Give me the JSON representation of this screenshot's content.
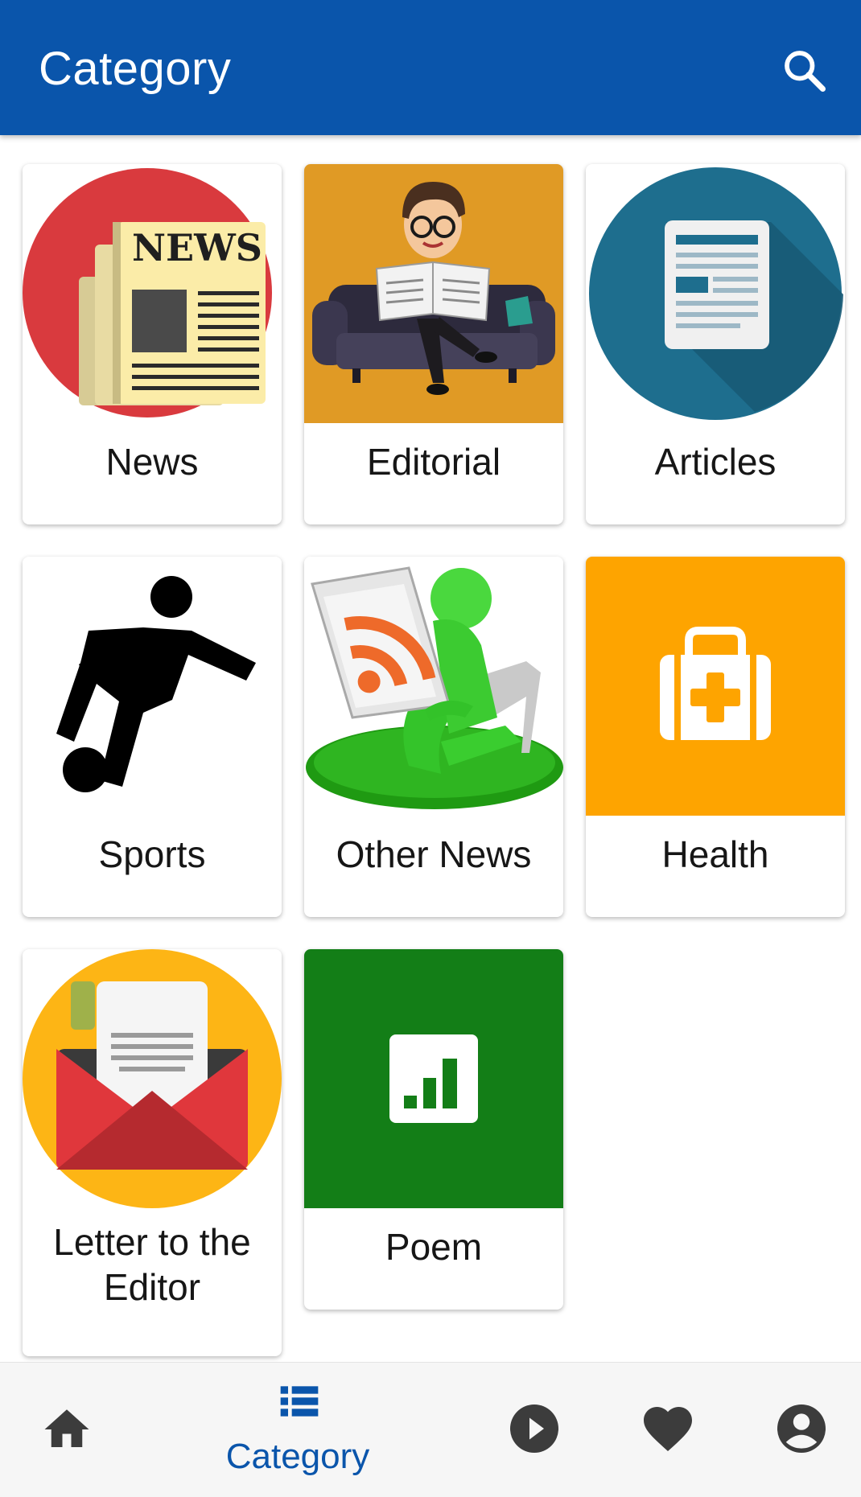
{
  "appbar": {
    "title": "Category",
    "search_icon": "search-icon"
  },
  "categories": [
    {
      "label": "News",
      "icon": "newspaper-icon"
    },
    {
      "label": "Editorial",
      "icon": "man-reading-newspaper-icon"
    },
    {
      "label": "Articles",
      "icon": "article-document-icon"
    },
    {
      "label": "Sports",
      "icon": "soccer-player-icon"
    },
    {
      "label": "Other News",
      "icon": "rss-reader-icon"
    },
    {
      "label": "Health",
      "icon": "medical-kit-icon"
    },
    {
      "label": "Letter to the Editor",
      "icon": "envelope-letter-icon"
    },
    {
      "label": "Poem",
      "icon": "signal-bars-icon"
    }
  ],
  "bottom_nav": {
    "items": [
      {
        "icon": "home-icon",
        "label": ""
      },
      {
        "icon": "list-icon",
        "label": "Category",
        "active": true
      },
      {
        "icon": "play-icon",
        "label": ""
      },
      {
        "icon": "heart-icon",
        "label": ""
      },
      {
        "icon": "account-icon",
        "label": ""
      }
    ]
  },
  "colors": {
    "primary": "#0a55ab",
    "inactive_icon": "#3c3c3c",
    "news_red": "#d93a3e",
    "editorial_bg": "#e09a25",
    "articles_teal": "#1e6e8e",
    "health_orange": "#fea400",
    "letter_yellow": "#fdb515",
    "poem_green": "#137e17"
  }
}
